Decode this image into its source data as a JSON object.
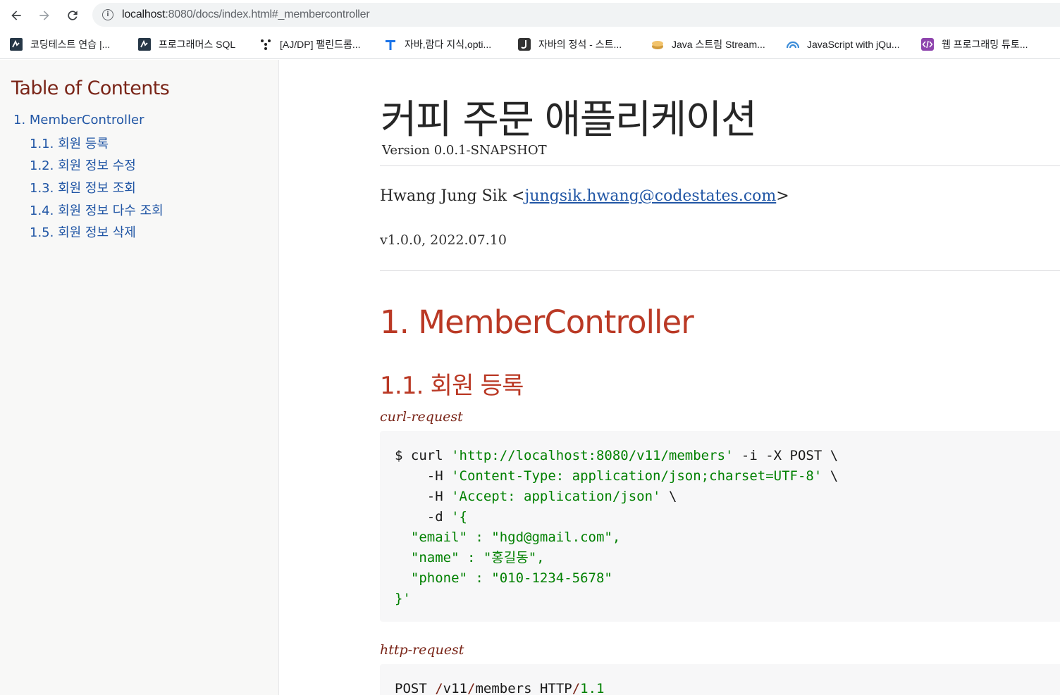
{
  "browser": {
    "url_host": "localhost",
    "url_rest": ":8080/docs/index.html#_membercontroller",
    "bookmarks": [
      {
        "label": "코딩테스트 연습 |...",
        "icon": "programmers-icon"
      },
      {
        "label": "프로그래머스 SQL",
        "icon": "programmers-icon"
      },
      {
        "label": "[AJ/DP] 팰린드롬...",
        "icon": "dots-icon"
      },
      {
        "label": "자바,람다 지식,opti...",
        "icon": "t-letter-icon"
      },
      {
        "label": "자바의 정석 - 스트...",
        "icon": "j-letter-icon"
      },
      {
        "label": "Java 스트림 Stream...",
        "icon": "coin-stack-icon"
      },
      {
        "label": "JavaScript with jQu...",
        "icon": "dome-icon"
      },
      {
        "label": "웹 프로그래밍 튜토...",
        "icon": "code-tag-icon"
      }
    ]
  },
  "toc": {
    "title": "Table of Contents",
    "items": [
      "1. MemberController",
      "1.1. 회원 등록",
      "1.2. 회원 정보 수정",
      "1.3. 회원 정보 조회",
      "1.4. 회원 정보 다수 조회",
      "1.5. 회원 정보 삭제"
    ]
  },
  "doc": {
    "title": "커피 주문 애플리케이션",
    "version": "Version 0.0.1-SNAPSHOT",
    "author_name": "Hwang Jung Sik",
    "author_email": "jungsik.hwang@codestates.com",
    "revision": "v1.0.0, 2022.07.10",
    "section1": "1. MemberController",
    "section2": "1.1. 회원 등록",
    "curl_title": "curl-request",
    "curl_lines": {
      "l1_cmd": "$ curl ",
      "l1_url": "'http://localhost:8080/v11/members'",
      "l1_rest": " -i -X POST \\",
      "l2_flag": "    -H ",
      "l2_val": "'Content-Type: application/json;charset=UTF-8'",
      "l2_end": " \\",
      "l3_flag": "    -H ",
      "l3_val": "'Accept: application/json'",
      "l3_end": " \\",
      "l4_flag": "    -d ",
      "l4_val": "'{",
      "l5": "  \"email\" : \"hgd@gmail.com\",",
      "l6": "  \"name\" : \"홍길동\",",
      "l7": "  \"phone\" : \"010-1234-5678\"",
      "l8": "}'"
    },
    "http_title": "http-request",
    "http_line": {
      "method": "POST ",
      "slash1": "/",
      "seg1": "v11",
      "slash2": "/",
      "seg2": "members",
      "proto": " HTTP",
      "slash3": "/",
      "ver": "1.1"
    }
  }
}
